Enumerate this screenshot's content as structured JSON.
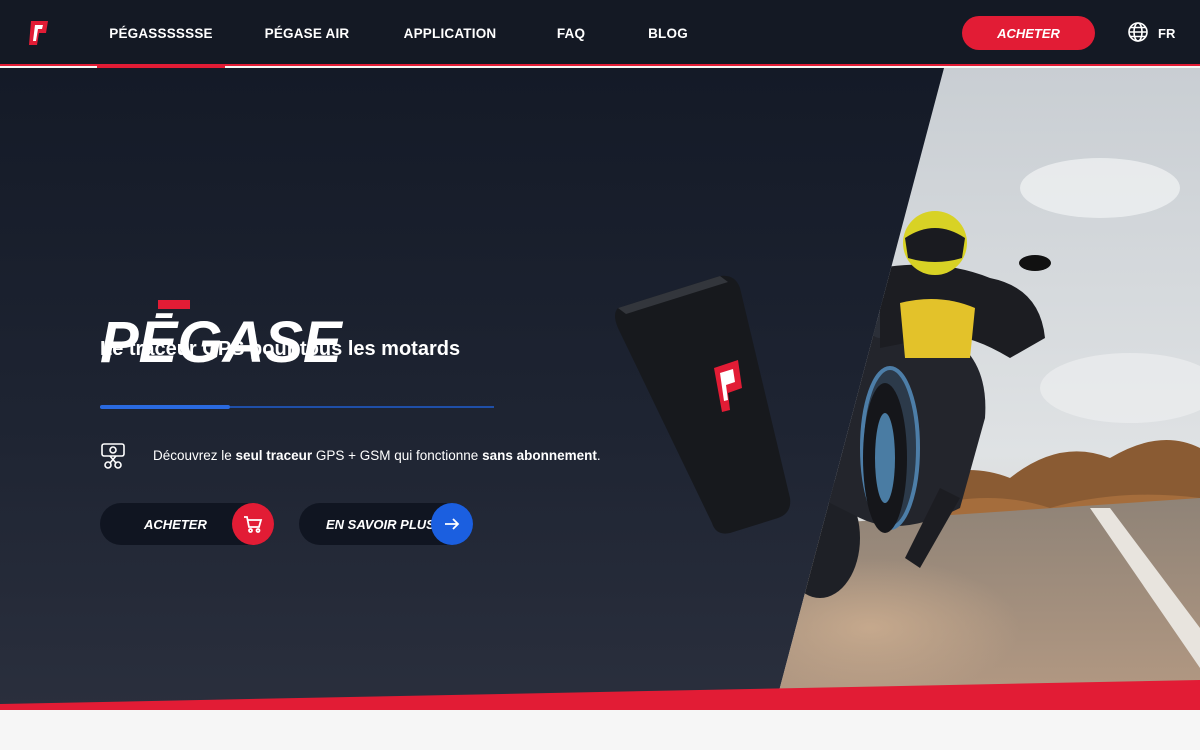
{
  "nav": {
    "logo_label": "p",
    "items": [
      {
        "label": "PÉGASSSSSSE",
        "active": true
      },
      {
        "label": "PÉGASE AIR",
        "active": false
      },
      {
        "label": "APPLICATION",
        "active": false
      },
      {
        "label": "FAQ",
        "active": false
      },
      {
        "label": "BLOG",
        "active": false
      }
    ],
    "buy_label": "ACHETER",
    "language": "FR"
  },
  "hero": {
    "brand": "PĒGASE",
    "tagline": "Le traceur GPS pour tous les motards",
    "feature": {
      "prefix": "Découvrez le ",
      "bold1": "seul traceur",
      "middle": " GPS + GSM qui fonctionne ",
      "bold2": "sans abonnement",
      "suffix": "."
    },
    "buy_button": "ACHETER",
    "more_button": "EN SAVOIR PLUS",
    "device_logo": "p"
  },
  "colors": {
    "accent_red": "#e21c35",
    "accent_blue": "#1b5fe0",
    "nav_bg": "#141924"
  },
  "icons": {
    "globe": "globe-icon",
    "cart": "cart-icon",
    "arrow": "arrow-right-icon",
    "feature": "money-cut-icon"
  }
}
